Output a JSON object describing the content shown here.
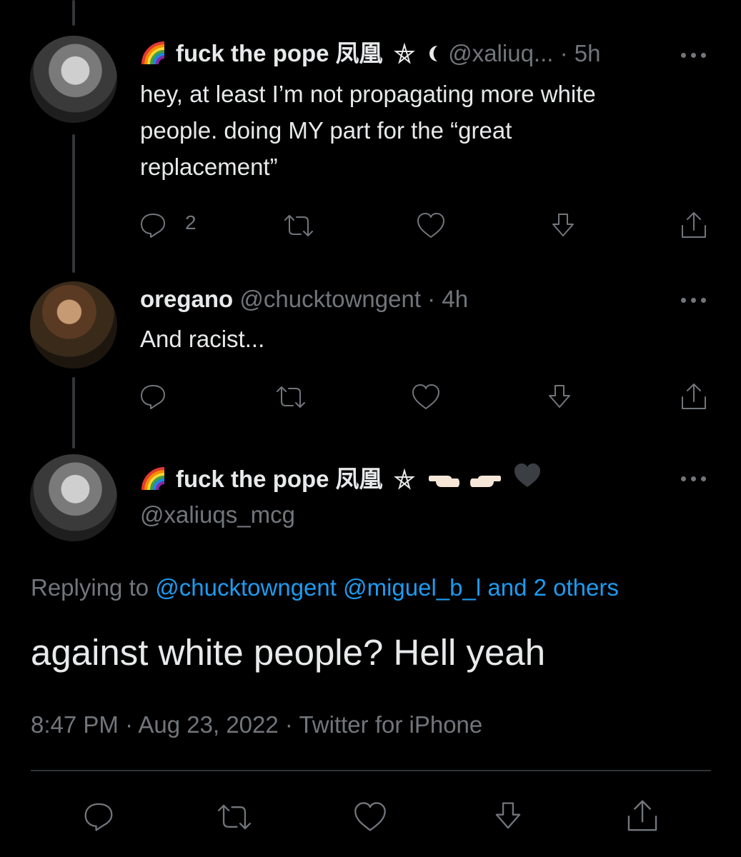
{
  "tweets": [
    {
      "display_name": "fuck the pope 凤凰",
      "handle": "@xaliuq...",
      "separator": "·",
      "time": "5h",
      "text_lines": [
        "hey, at least I’m not propagating more white",
        "people. doing MY part for the “great",
        "replacement”"
      ],
      "reply_count": "2"
    },
    {
      "display_name": "oregano",
      "handle": "@chucktowngent",
      "separator": "·",
      "time": "4h",
      "text_lines": [
        "And racist..."
      ]
    }
  ],
  "main_tweet": {
    "display_name": "fuck the pope 凤凰",
    "handle": "@xaliuqs_mcg",
    "replying_prefix": "Replying to",
    "replying_to": "@chucktowngent @miguel_b_l and 2 others",
    "text": "against white people? Hell yeah",
    "timestamp": "8:47 PM · Aug 23, 2022 · Twitter for iPhone"
  },
  "icons": [
    "reply-icon",
    "retweet-icon",
    "like-icon",
    "download-icon",
    "share-icon",
    "more-icon",
    "rainbow-icon",
    "pentagram-icon",
    "moon-icon",
    "pointing-hand-icon",
    "heart-icon"
  ],
  "colors": {
    "background": "#000000",
    "text": "#e7e9ea",
    "muted": "#71767b",
    "link": "#1d9bf0"
  }
}
